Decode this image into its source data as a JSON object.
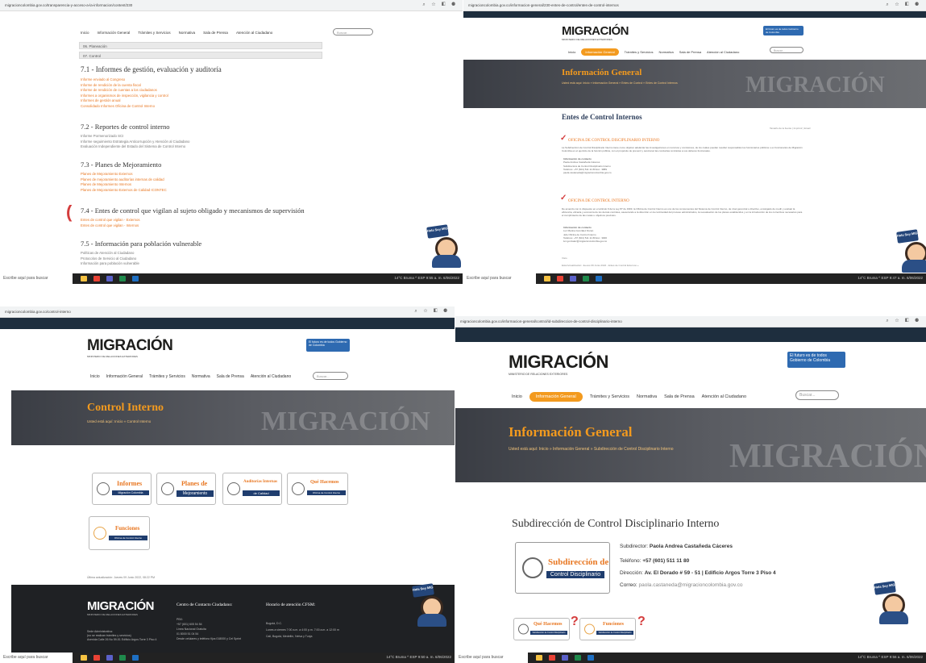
{
  "panel1": {
    "url": "migracioncolombia.gov.co/transparencia-y-acceso-a-la-informacion/content/230",
    "nav": [
      "Inicio",
      "Información General",
      "Trámites y Servicios",
      "Normativa",
      "Sala de Prensa",
      "Atención al Ciudadano"
    ],
    "search_placeholder": "Buscar...",
    "accordion": [
      "06. Planeación",
      "07. Control"
    ],
    "sections": [
      {
        "title": "7.1 - Informes de gestión, evaluación y auditoría",
        "color": "orange",
        "items": [
          "Informe enviado al Congreso",
          "Informe de rendición de la cuenta fiscal",
          "Informe de rendición de cuentas a los ciudadanos",
          "Informes a organismos de inspección, vigilancia y control",
          "Informes de gestión anual",
          "Consolidado Informes Oficina de Control Interno"
        ]
      },
      {
        "title": "7.2 - Reportes de control interno",
        "color": "grey",
        "items": [
          "Informe Pormenorizado SCI",
          "Informe seguimiento Estrategia Anticorrupción y Atención al Ciudadano",
          "Evaluación Independiente del Estado del Sistema de Control Interno"
        ]
      },
      {
        "title": "7.3 - Planes de Mejoramiento",
        "color": "orange",
        "items": [
          "Planes de Mejoramiento Externos",
          "Planes de mejoramiento auditorías internas de calidad",
          "Planes de Mejoramiento Internos",
          "Planes de Mejoramiento Externos de Calidad ICONTEC"
        ]
      },
      {
        "title": "7.4 - Entes de control que vigilan al sujeto obligado y mecanismos de supervisión",
        "color": "orange",
        "items": [
          "Entes de control que vigilan - Externos",
          "Entes de control que vigilan - Internos"
        ]
      },
      {
        "title": "7.5 - Información para población vulnerable",
        "color": "grey",
        "items": [
          "Políticas de Atención al Ciudadano",
          "Protocolos de Servicio al Ciudadano",
          "Información para población vulnerable"
        ]
      }
    ],
    "taskbar_search": "Escribe aquí para buscar",
    "tray": "14°C Bruma  ^ ESP  9:55 a. m.  6/06/2022"
  },
  "panel2": {
    "url": "migracioncolombia.gov.co/informacion-general/230-entes-de-control/entes-de-control-internos",
    "logo": "MIGRACIÓN",
    "logo_sub": "MINISTERIO DE RELACIONES EXTERIORES",
    "gov": "El futuro es de todos  Gobierno de Colombia",
    "nav": [
      "Inicio",
      "Información General",
      "Trámites y Servicios",
      "Normativa",
      "Sala de Prensa",
      "Atención al Ciudadano"
    ],
    "search_placeholder": "Buscar...",
    "banner_title": "Información General",
    "crumb": "Usted está aquí:  Inicio »  Información General »  Entes de Control »  Entes de Control Internos",
    "watermark": "MIGRACIÓN",
    "heading": "Entes de Control Internos",
    "tools": "Tamaño de la fuente  |  Imprimir  |  Email",
    "office1_title": "OFICINA DE CONTROL DISCIPLINARIO INTERNO",
    "office1_text": "La Subdirección de Control Disciplinario Interno tiene como objetivo adelantar las investigaciones en recursos y comisiones, de los cuales puedan resultar responsables los funcionarios públicos o ex funcionarios de Migración Colombia en el ejercicio de la función pública, con el propósito de prevenir y sancionar las conductas contrarias a sus deberes funcionales.",
    "office1_contact": [
      "Información de contacto",
      "Paola Andrea Castañeda Cáceres",
      "Subdirectora de Control Disciplinario Interno",
      "Teléfono: +57 (601) 511 11 80 Ext.: 3889",
      "paola.castaneda@migracioncolombia.gov.co"
    ],
    "office2_title": "OFICINA DE CONTROL INTERNO",
    "office2_text": "De acuerdo con lo dispuesto en el artículo 9 de la Ley 87 de 1993, la Oficina de Control Interno es uno de los componentes del Sistema de Control Interno, de nivel gerencial o directivo, encargado de medir y evaluar la eficiencia, eficacia y economía de los demás controles, asesorando a la dirección en la continuidad del proceso administrativo, la reevaluación de los planes establecidos y en la introducción de los correctivos necesarios para el cumplimiento de las metas u objetivos previstos.",
    "office2_contact": [
      "Información de contacto",
      "Luz Marina González Duran",
      "Jefe Oficina de Control Interno",
      "Teléfono: +57 (601) 511 11 80 Ext.: 3000",
      "luz.gonzalez@migracioncolombia.gov.co"
    ],
    "footer_links": [
      "Visto",
      "Está Actualización: Jueves 09 Junio 2022  -  Entes de Control Externos »"
    ],
    "mascot_sign": "Hola Soy MIG",
    "taskbar_search": "Escribe aquí para buscar",
    "tray": "14°C Bruma  ^ ESP  9:47 a. m.  6/06/2022"
  },
  "panel3": {
    "url": "migracioncolombia.gov.co/control-interno",
    "logo": "MIGRACIÓN",
    "logo_sub": "MINISTERIO DE RELACIONES EXTERIORES",
    "gov": "El futuro es de todos  Gobierno de Colombia",
    "nav": [
      "Inicio",
      "Información General",
      "Trámites y Servicios",
      "Normativa",
      "Sala de Prensa",
      "Atención al Ciudadano"
    ],
    "search_placeholder": "Buscar...",
    "banner_title": "Control Interno",
    "crumb": "Usted está aquí:  Inicio »  Control Interno",
    "watermark": "MIGRACIÓN",
    "cards": [
      {
        "title": "Informes",
        "sub": "Migración Colombia"
      },
      {
        "title": "Planes de",
        "sub": "Mejoramiento"
      },
      {
        "title": "Auditorías Internas",
        "sub": "de Calidad"
      },
      {
        "title": "Qué Hacemos",
        "sub": "Oficina de Control Interno"
      },
      {
        "title": "Funciones",
        "sub": "Oficina de Control Interno"
      }
    ],
    "last_update": "Última actualización: Jueves 09 Junio 2022, 08:22 PM",
    "footer_col1": [
      "Sede Administrativa:",
      "(no se realizan trámites y servicios)",
      "Avenida Calle 26 No 59-51 Edificio Argos Torre 3 Piso 4"
    ],
    "footer_col2_title": "Centro de Contacto Ciudadano:",
    "footer_col2": [
      "PBX:",
      "+57 (601) 605 54 54",
      "Línea Nacional Gratuita",
      "01 8000 51 04 54",
      "Desde celulares y teléfono fijos 018000 y Cel Sprint"
    ],
    "footer_col3_title": "Horario de atención CFSM:",
    "footer_col3": [
      "Bogotá, D.C.",
      "Lunes a viernes    7:00 a.m. a 4:00 p.m. 7:00 a.m. a 12:00 m",
      "Cali, Bogotá, Medellín, Neiva y Tunja"
    ],
    "mascot_sign": "Hola Soy MIG",
    "taskbar_search": "Escribe aquí para buscar",
    "tray": "14°C Bruma  ^ ESP  9:50 a. m.  6/06/2022"
  },
  "panel4": {
    "url": "migracioncolombia.gov.co/informacion-general/control/id-subdireccion-de-control-disciplinario-interno",
    "logo": "MIGRACIÓN",
    "logo_sub": "MINISTERIO DE RELACIONES EXTERIORES",
    "gov": "El futuro es de todos  Gobierno de Colombia",
    "nav": [
      "Inicio",
      "Información General",
      "Trámites y Servicios",
      "Normativa",
      "Sala de Prensa",
      "Atención al Ciudadano"
    ],
    "search_placeholder": "Buscar...",
    "banner_title": "Información General",
    "crumb": "Usted está aquí:  Inicio »  Información General »  Subdirección de Control Disciplinario Interno",
    "watermark": "MIGRACIÓN",
    "heading": "Subdirección de Control Disciplinario Interno",
    "subdirector_label": "Subdirector:",
    "subdirector_name": "Paola Andrea Castañeda Cáceres",
    "phone_label": "Teléfono:",
    "phone": "+57 (601) 511 11 80",
    "address_label": "Dirección:",
    "address": "Av. El Dorado # 59 - 51 | Edificio Argos Torre 3 Piso 4",
    "email_label": "Correo:",
    "email": "paola.castaneda@migracioncolombia.gov.co",
    "card_title": "Subdirección de",
    "card_sub": "Control Disciplinario",
    "small_cards": [
      {
        "title": "Qué Hacemos",
        "sub": "Subdirección de Control Disciplinario"
      },
      {
        "title": "Funciones",
        "sub": "Subdirección de Control Disciplinario"
      }
    ],
    "mascot_sign": "Hola Soy MIG",
    "taskbar_search": "Escribe aquí para buscar",
    "tray": "14°C Bruma  ^ ESP  9:56 a. m.  6/06/2022"
  }
}
